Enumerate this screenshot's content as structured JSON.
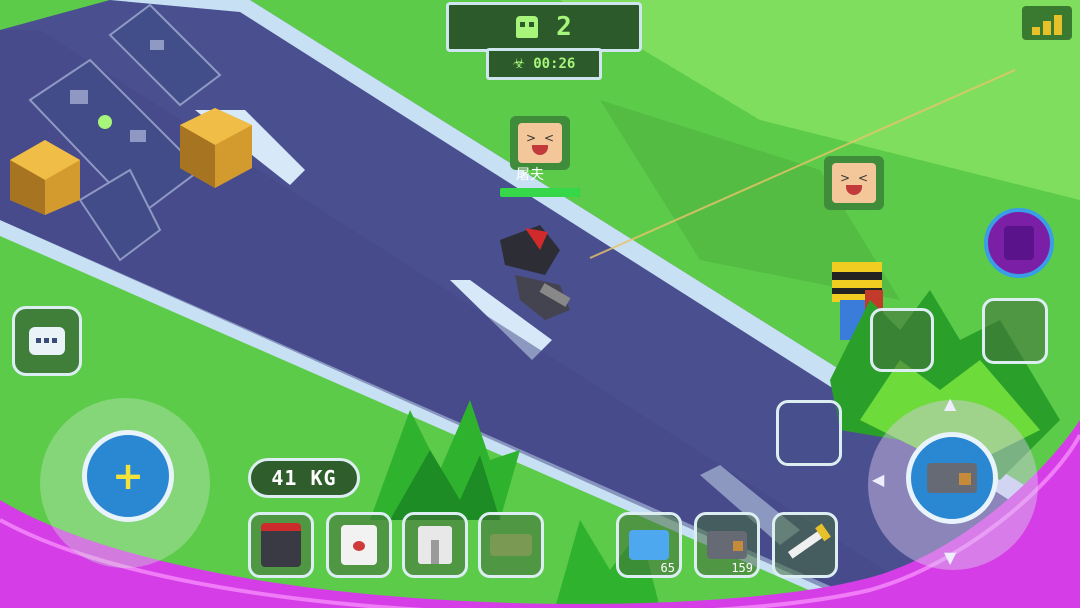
{
  "hud": {
    "players_alive": "2",
    "timer": "00:26",
    "weight": "41 KG"
  },
  "player": {
    "name": "屠夫",
    "health_pct": 100
  },
  "inventory": {
    "slots": [
      {
        "name": "armor-slot",
        "icon": "red-armor-icon",
        "count": ""
      },
      {
        "name": "chest-slot",
        "icon": "white-vest-icon",
        "count": ""
      },
      {
        "name": "legs-slot",
        "icon": "pants-icon",
        "count": ""
      },
      {
        "name": "vehicle-slot",
        "icon": "tank-icon",
        "count": ""
      },
      {
        "name": "ammo-slot-1",
        "icon": "blue-ammo-icon",
        "count": "65"
      },
      {
        "name": "ammo-slot-2",
        "icon": "gray-ammo-icon",
        "count": "159"
      },
      {
        "name": "melee-slot",
        "icon": "sword-icon",
        "count": ""
      }
    ]
  },
  "colors": {
    "grass": "#5ccb4a",
    "road": "#4a4f8f",
    "hud_text": "#a7f57a",
    "zone": "#d53ee6"
  }
}
